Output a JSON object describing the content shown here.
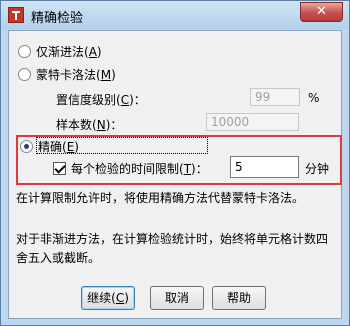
{
  "window": {
    "title": "精确检验",
    "close_glyph": "✕"
  },
  "options": {
    "asymptotic": {
      "label": "仅渐进法",
      "mnemonic": "A",
      "selected": false
    },
    "monte_carlo": {
      "label": "蒙特卡洛法",
      "mnemonic": "M",
      "selected": false,
      "confidence": {
        "label": "置信度级别",
        "mnemonic": "C",
        "value": "99",
        "unit": "%"
      },
      "samples": {
        "label": "样本数",
        "mnemonic": "N",
        "value": "10000"
      }
    },
    "exact": {
      "label": "精确",
      "mnemonic": "E",
      "selected": true,
      "time_limit": {
        "label": "每个检验的时间限制",
        "mnemonic": "T",
        "checked": true,
        "value": "5",
        "unit": "分钟"
      }
    }
  },
  "notes": {
    "note1": "在计算限制允许时，将使用精确方法代替蒙特卡洛法。",
    "note2_line1": "对于非渐进方法，在计算检验统计时，始终将单元格计数四",
    "note2_line2": "舍五入或截断。"
  },
  "buttons": {
    "continue": {
      "label": "继续",
      "mnemonic": "C"
    },
    "cancel": {
      "label": "取消"
    },
    "help": {
      "label": "帮助"
    }
  },
  "colors": {
    "highlight_border": "#e03a3a",
    "title_bar": "#bdd7ee",
    "close_button": "#c75050"
  }
}
